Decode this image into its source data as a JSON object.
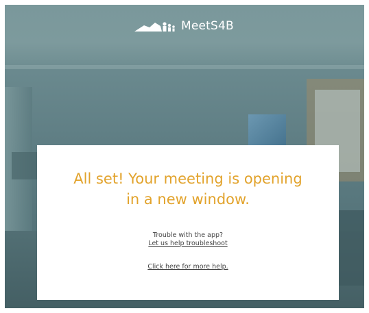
{
  "header": {
    "brand": "MeetS4B",
    "brand_color": "#ffffff"
  },
  "dialog": {
    "headline_line1": "All set! Your meeting is opening",
    "headline_line2": "in a new window.",
    "headline_color": "#e2a32c",
    "trouble_text": "Trouble with the app?",
    "troubleshoot_link": "Let us help troubleshoot",
    "more_help_link": "Click here for more help."
  },
  "icons": {
    "logo": "meets4b-logo-icon"
  }
}
